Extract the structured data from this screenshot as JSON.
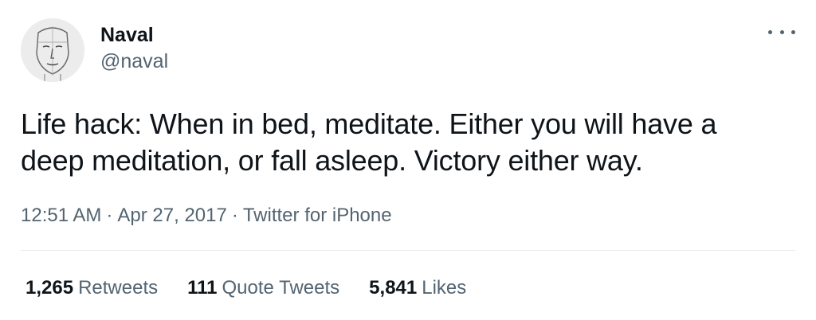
{
  "user": {
    "display_name": "Naval",
    "handle": "@naval"
  },
  "tweet": {
    "text": "Life hack: When in bed, meditate. Either you will have a deep meditation, or fall asleep. Victory either way.",
    "time": "12:51 AM",
    "separator": "·",
    "date": "Apr 27, 2017",
    "source": "Twitter for iPhone"
  },
  "stats": {
    "retweets_count": "1,265",
    "retweets_label": "Retweets",
    "quotes_count": "111",
    "quotes_label": "Quote Tweets",
    "likes_count": "5,841",
    "likes_label": "Likes"
  },
  "icons": {
    "more": "more-horizontal-icon"
  },
  "colors": {
    "primary_text": "#0f1419",
    "secondary_text": "#536471",
    "divider": "#e6e9eb",
    "background": "#ffffff"
  }
}
